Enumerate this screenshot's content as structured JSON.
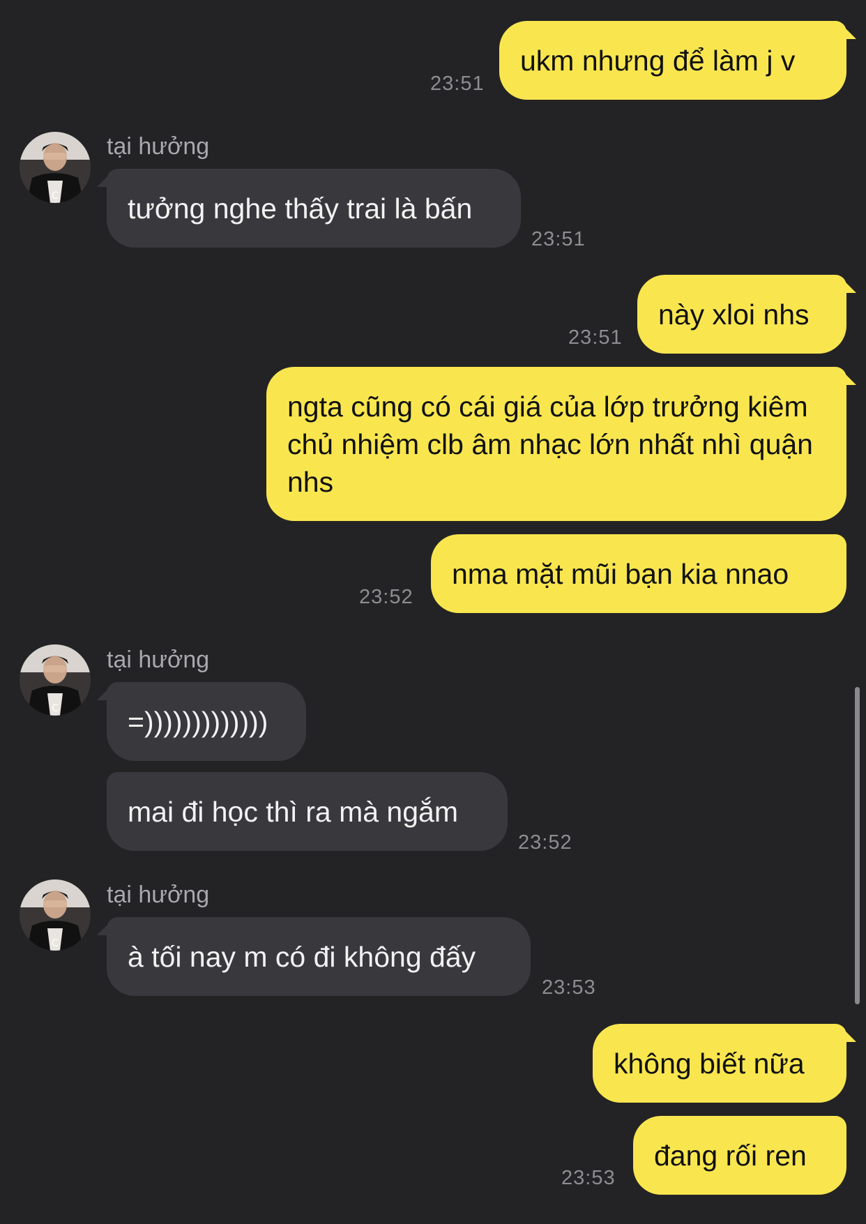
{
  "contact": {
    "name": "tại hưởng",
    "avatar_icon": "user-avatar-photo"
  },
  "colors": {
    "background": "#232325",
    "outgoing_bubble": "#f9e64f",
    "incoming_bubble": "#39393d",
    "timestamp": "#8e8e92",
    "sender_name": "#a8a8ad"
  },
  "messages": [
    {
      "direction": "out",
      "text": "ukm nhưng để làm j v",
      "time": "23:51"
    },
    {
      "direction": "in",
      "sender": "tại hưởng",
      "text": "tưởng nghe thấy trai là bấn",
      "time": "23:51"
    },
    {
      "direction": "out",
      "text": "này xloi nhs",
      "time": "23:51"
    },
    {
      "direction": "out",
      "text": "ngta cũng có cái giá của lớp trưởng kiêm chủ nhiệm clb âm nhạc lớn nhất nhì quận nhs"
    },
    {
      "direction": "out",
      "text": "nma mặt mũi bạn kia nnao",
      "time": "23:52"
    },
    {
      "direction": "in",
      "sender": "tại hưởng",
      "text": "=)))))))))))))"
    },
    {
      "direction": "in",
      "text": "mai đi học thì ra mà ngắm",
      "time": "23:52"
    },
    {
      "direction": "in",
      "sender": "tại hưởng",
      "text": "à tối nay m có đi không đấy",
      "time": "23:53"
    },
    {
      "direction": "out",
      "text": "không biết nữa"
    },
    {
      "direction": "out",
      "text": "đang rối ren",
      "time": "23:53"
    }
  ]
}
